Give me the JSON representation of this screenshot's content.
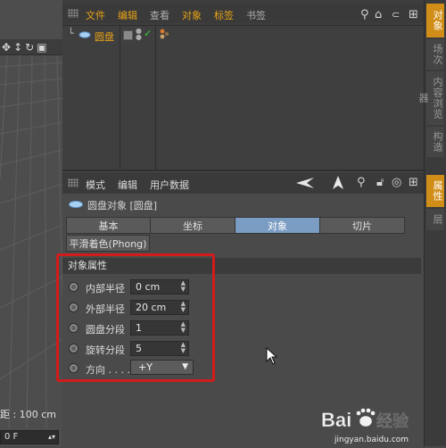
{
  "viewport": {
    "distance_label": "距 : 100 cm",
    "frame_value": "0 F"
  },
  "object_manager": {
    "menu": [
      "文件",
      "编辑",
      "查看",
      "对象",
      "标签",
      "书签"
    ],
    "object_name": "圆盘"
  },
  "right_tabs": {
    "top": [
      "对象",
      "场次",
      "内容浏览器",
      "构造"
    ],
    "bottom": [
      "属性",
      "层"
    ]
  },
  "attribute_manager": {
    "menu": [
      "模式",
      "编辑",
      "用户数据"
    ],
    "object_title": "圆盘对象 [圆盘]",
    "tabs": [
      "基本",
      "坐标",
      "对象",
      "切片"
    ],
    "active_tab": "对象",
    "tab_row2": "平滑着色(Phong)",
    "section_title": "对象属性",
    "params": [
      {
        "label": "内部半径",
        "value": "0 cm"
      },
      {
        "label": "外部半径",
        "value": "20 cm"
      },
      {
        "label": "圆盘分段",
        "value": "1"
      },
      {
        "label": "旋转分段",
        "value": "5"
      }
    ],
    "direction": {
      "label": "方向 . . . .",
      "value": "+Y"
    }
  },
  "watermark": {
    "logo": "Bai 经验",
    "url": "jingyan.baidu.com"
  },
  "colors": {
    "accent": "#e8a317",
    "active_tab": "#7b9cc3",
    "highlight": "#d21b1b"
  }
}
